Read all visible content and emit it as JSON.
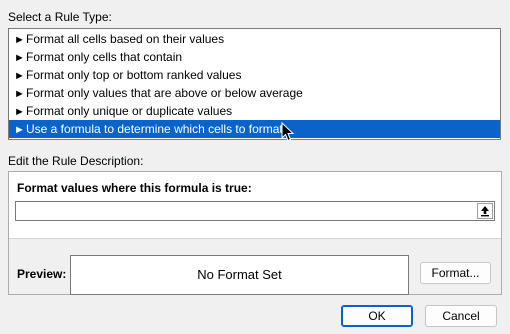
{
  "rule_type": {
    "label": "Select a Rule Type:",
    "items": [
      {
        "label": "Format all cells based on their values",
        "selected": false
      },
      {
        "label": "Format only cells that contain",
        "selected": false
      },
      {
        "label": "Format only top or bottom ranked values",
        "selected": false
      },
      {
        "label": "Format only values that are above or below average",
        "selected": false
      },
      {
        "label": "Format only unique or duplicate values",
        "selected": false
      },
      {
        "label": "Use a formula to determine which cells to format",
        "selected": true
      }
    ]
  },
  "description": {
    "label": "Edit the Rule Description:",
    "formula_label": "Format values where this formula is true:",
    "formula_value": "",
    "preview_label": "Preview:",
    "preview_text": "No Format Set",
    "format_button": "Format..."
  },
  "buttons": {
    "ok": "OK",
    "cancel": "Cancel"
  },
  "icons": {
    "rule_bullet": "arrow-right-icon",
    "collapse": "collapse-dialog-icon",
    "cursor": "mouse-pointer-icon"
  },
  "colors": {
    "selection": "#0a63c9",
    "background": "#f0f0f0"
  }
}
